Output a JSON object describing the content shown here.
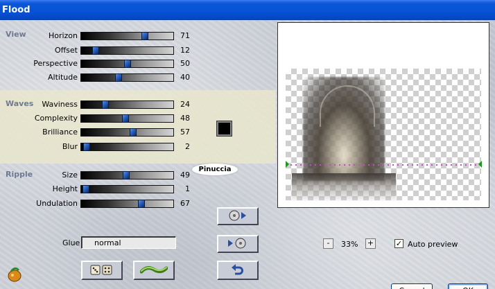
{
  "window": {
    "title": "Flood"
  },
  "sections": {
    "view": "View",
    "waves": "Waves",
    "ripple": "Ripple"
  },
  "sliders": [
    {
      "label": "Horizon",
      "value": 71
    },
    {
      "label": "Offset",
      "value": 12
    },
    {
      "label": "Perspective",
      "value": 50
    },
    {
      "label": "Altitude",
      "value": 40
    },
    {
      "label": "Waviness",
      "value": 24
    },
    {
      "label": "Complexity",
      "value": 48
    },
    {
      "label": "Brilliance",
      "value": 57
    },
    {
      "label": "Blur",
      "value": 2
    },
    {
      "label": "Size",
      "value": 49
    },
    {
      "label": "Height",
      "value": 1
    },
    {
      "label": "Undulation",
      "value": 67
    }
  ],
  "color_swatch": "#000000",
  "watermark": "Pinuccia",
  "glue": {
    "label": "Glue",
    "value": "normal"
  },
  "preview": {
    "zoom_out": "-",
    "zoom_in": "+",
    "zoom": "33%",
    "auto_preview_label": "Auto preview",
    "auto_preview_checked": "✓"
  },
  "buttons": {
    "cancel": "Cancel",
    "ok": "OK"
  },
  "icons": {
    "app": "filter-app-icon",
    "randomize": "dice-icon",
    "wave_preset": "wave-icon",
    "save_preset": "disc-arrow-right-icon",
    "load_preset": "arrow-disc-icon",
    "reset": "undo-icon"
  }
}
